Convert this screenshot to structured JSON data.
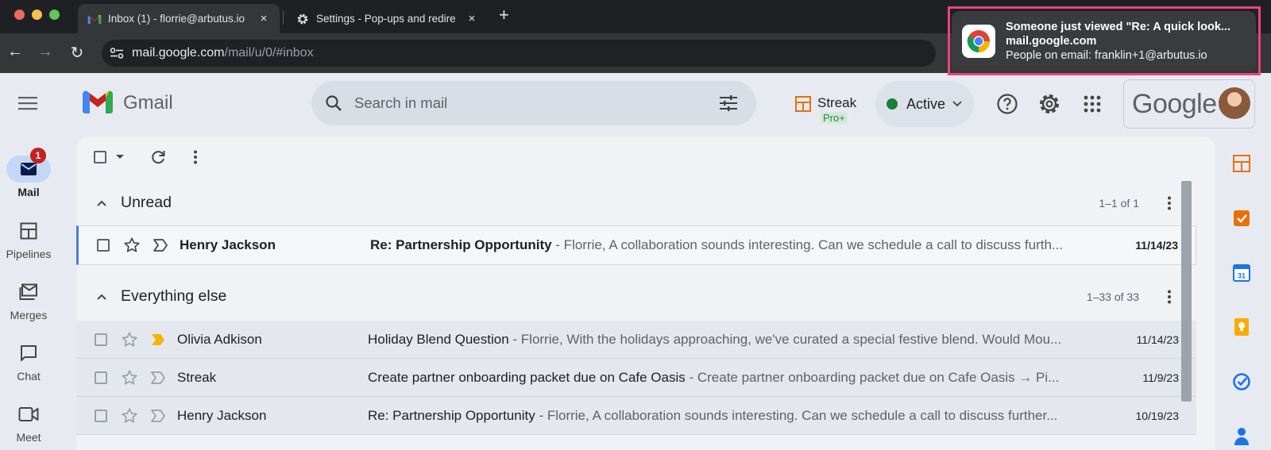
{
  "browser": {
    "tabs": [
      {
        "title": "Inbox (1) - florrie@arbutus.io",
        "icon": "gmail-icon",
        "active": true
      },
      {
        "title": "Settings - Pop-ups and redire",
        "icon": "gear-icon",
        "active": false
      }
    ],
    "close_glyph": "×",
    "newtab_glyph": "+",
    "back_glyph": "←",
    "forward_glyph": "→",
    "reload_glyph": "↻",
    "url_host": "mail.google.com",
    "url_path": "/mail/u/0/#inbox"
  },
  "notification": {
    "line1": "Someone just viewed \"Re: A quick look...",
    "line2": "mail.google.com",
    "line3": "People on email: franklin+1@arbutus.io"
  },
  "header": {
    "app_name": "Gmail",
    "search_placeholder": "Search in mail",
    "streak_label": "Streak",
    "streak_badge": "Pro+",
    "status_label": "Active",
    "account_word": "Google"
  },
  "rail": [
    {
      "label": "Mail",
      "icon": "mail-icon",
      "badge": "1",
      "selected": true
    },
    {
      "label": "Pipelines",
      "icon": "pipelines-icon",
      "selected": false
    },
    {
      "label": "Merges",
      "icon": "merges-icon",
      "selected": false
    },
    {
      "label": "Chat",
      "icon": "chat-icon",
      "selected": false
    },
    {
      "label": "Meet",
      "icon": "meet-icon",
      "selected": false
    }
  ],
  "sections": {
    "unread": {
      "title": "Unread",
      "count": "1–1 of 1"
    },
    "everything": {
      "title": "Everything else",
      "count": "1–33 of 33"
    }
  },
  "unread_rows": [
    {
      "sender": "Henry Jackson",
      "subject": "Re: Partnership Opportunity",
      "snippet": " - Florrie, A collaboration sounds interesting. Can we schedule a call to discuss furth...",
      "date": "11/14/23"
    }
  ],
  "rows": [
    {
      "sender": "Olivia Adkison",
      "subject": "Holiday Blend Question",
      "snippet": " - Florrie, With the holidays approaching, we've curated a special festive blend. Would Mou...",
      "date": "11/14/23",
      "important": true
    },
    {
      "sender": "Streak",
      "subject": "Create partner onboarding packet due on Cafe Oasis",
      "snippet": " - Create partner onboarding packet due on Cafe Oasis → Pi...",
      "date": "11/9/23",
      "important": false
    },
    {
      "sender": "Henry Jackson",
      "subject": "Re: Partnership Opportunity",
      "snippet": " - Florrie, A collaboration sounds interesting. Can we schedule a call to discuss further...",
      "date": "10/19/23",
      "important": false
    }
  ],
  "side_panel": [
    "streak-icon",
    "tasks-icon",
    "calendar-icon",
    "keep-icon",
    "tasks-check-icon",
    "contacts-icon"
  ],
  "colors": {
    "accent_blue": "#0b57d0",
    "active_green": "#188038",
    "important_yellow": "#f2b600",
    "notification_border": "#e8457f"
  }
}
